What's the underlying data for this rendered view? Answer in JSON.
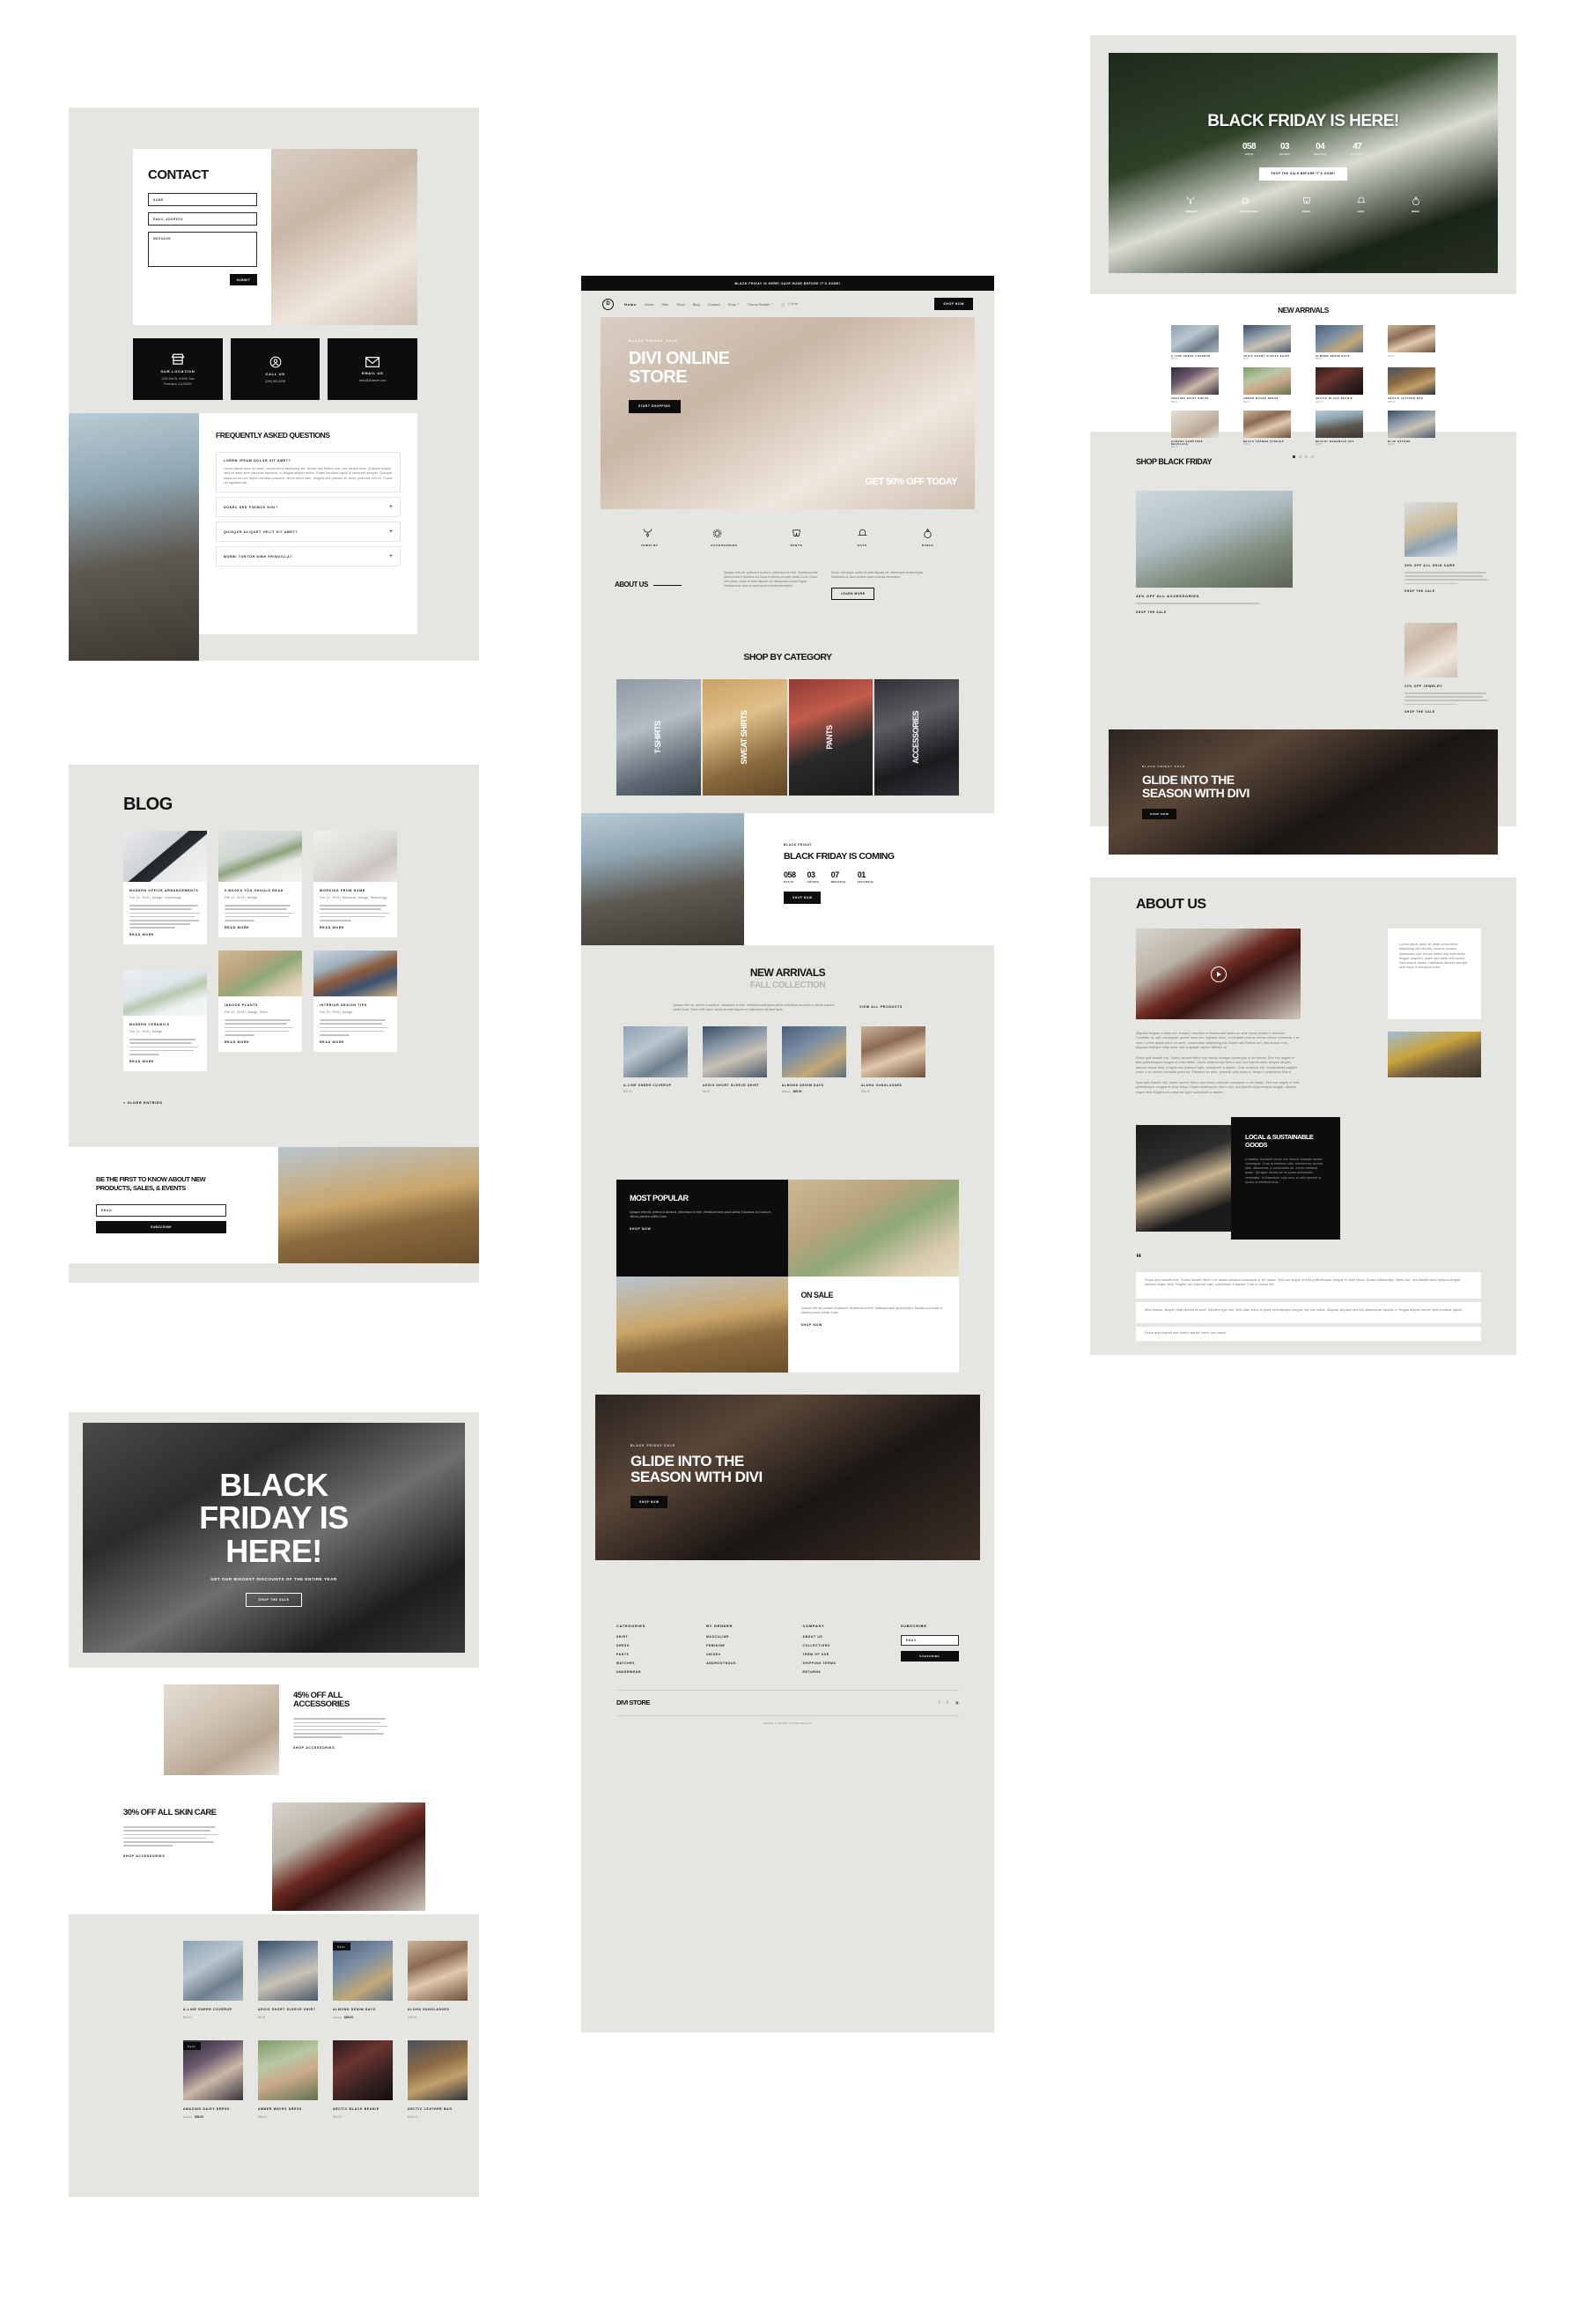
{
  "contact_page": {
    "title": "CONTACT",
    "form": {
      "name_placeholder": "NAME",
      "email_placeholder": "EMAIL ADDRESS",
      "message_placeholder": "MESSAGE",
      "submit_label": "SUBMIT"
    },
    "info_cards": [
      {
        "icon": "store-icon",
        "title": "OUR LOCATION",
        "line1": "1234 Divi St. #1000, San",
        "line2": "Francisco, CA 94220"
      },
      {
        "icon": "phone-user-icon",
        "title": "CALL US",
        "line1": "(255) 352-6258",
        "line2": ""
      },
      {
        "icon": "envelope-icon",
        "title": "EMAIL US",
        "line1": "hello@divistore.com",
        "line2": ""
      }
    ],
    "faq": {
      "title": "FREQUENTLY ASKED QUESTIONS",
      "items": [
        {
          "q": "LOREM IPSUM DOLOR SIT AMET?",
          "open": true,
          "a": "Lorem ipsum dolor sit amet, consectetur adipiscing elit. Donec sed finibus nisi, sed dictum eros. Quisque aliquet velit sit amet sem interdum faucibus. In feugiat aliquet mollis. Etiam tincidunt ligula ut hendrerit semper. Quisque luctus tortor non turpis interdum posuere. Morbi tortor nibh, fringilla sed pretium sit amet, pharetra non ex. Fusce vel egestas nisl."
        },
        {
          "q": "DONEC SED FINIBUS NISI?",
          "open": false,
          "a": ""
        },
        {
          "q": "QUISQUE ALIQUET VELIT SIT AMET?",
          "open": false,
          "a": ""
        },
        {
          "q": "MORBI TORTOR NIBH FRINGILLA?",
          "open": false,
          "a": ""
        }
      ]
    }
  },
  "blog_page": {
    "title": "BLOG",
    "read_more": "READ MORE",
    "older_entries": "« OLDER ENTRIES",
    "posts": [
      {
        "title": "MODERN OFFICE ARRANGEMENTS",
        "meta": "Feb 12, 2019 | Design, Technology",
        "img": "img-blog1"
      },
      {
        "title": "5 BOOKS YOU SHOULD READ",
        "meta": "Feb 12, 2019 | Design",
        "img": "img-blog2"
      },
      {
        "title": "WORKING FROM HOME",
        "meta": "Feb 12, 2019 | Business, Design, Technology",
        "img": "img-blog3"
      },
      {
        "title": "MODERN CERAMICS",
        "meta": "Feb 12, 2019 | Design",
        "img": "img-blog4"
      },
      {
        "title": "INDOOR PLANTS",
        "meta": "Feb 12, 2019 | Design, Store",
        "img": "img-blog5"
      },
      {
        "title": "INTERIOR DESIGN TIPS",
        "meta": "Feb 12, 2019 | Design",
        "img": "img-blog6"
      }
    ],
    "newsletter": {
      "heading": "BE THE FIRST TO KNOW ABOUT NEW PRODUCTS, SALES, & EVENTS",
      "email_placeholder": "EMAIL",
      "button_label": "SUBSCRIBE"
    }
  },
  "black_friday_page": {
    "hero": {
      "title": "BLACK FRIDAY IS HERE!",
      "subtitle": "GET OUR BIGGEST DISCOUNTS OF THE ENTIRE YEAR",
      "button_label": "SHOP THE SALE"
    },
    "promo_accessories": {
      "title": "45% OFF ALL ACCESSORIES",
      "link_label": "SHOP ACCESSORIES"
    },
    "promo_skincare": {
      "title": "30% OFF ALL SKIN CARE",
      "link_label": "SHOP ACCESSORIES"
    },
    "products": [
      {
        "name": "A-LINE SHEER COVERUP",
        "price": "$67.00",
        "old_price": "",
        "badge": "",
        "img": "p1"
      },
      {
        "name": "AEGIS SHORT SLEEVE SHIRT",
        "price": "$6.00",
        "old_price": "",
        "badge": "",
        "img": "p2"
      },
      {
        "name": "ALMOND DENIM DAYS",
        "price": "$68.00",
        "old_price": "$95.00",
        "badge": "Sale!",
        "img": "p3"
      },
      {
        "name": "ALOHA SUNGLASSES",
        "price": "$48.00",
        "old_price": "",
        "badge": "",
        "img": "p4"
      },
      {
        "name": "AMAZING DAISY DRESS",
        "price": "$56.00",
        "old_price": "$80.00",
        "badge": "Sale!",
        "img": "p5"
      },
      {
        "name": "AMBER WAVES DRESS",
        "price": "$64.00",
        "old_price": "",
        "badge": "",
        "img": "p6"
      },
      {
        "name": "ARCTIC BLACK BEANIE",
        "price": "$22.00",
        "old_price": "",
        "badge": "",
        "img": "p7"
      },
      {
        "name": "ARCTIC LEATHER BAG",
        "price": "$150.00",
        "old_price": "",
        "badge": "",
        "img": "p8"
      }
    ]
  },
  "home_page": {
    "announcement": "BLACK FRIDAY IS HERE! SAVE HUGE BEFORE IT'S GONE!",
    "logo": "D",
    "nav": [
      {
        "label": "Home",
        "active": true,
        "caret": false
      },
      {
        "label": "About",
        "active": false,
        "caret": false
      },
      {
        "label": "Sale",
        "active": false,
        "caret": false
      },
      {
        "label": "Shop",
        "active": false,
        "caret": false
      },
      {
        "label": "Blog",
        "active": false,
        "caret": false
      },
      {
        "label": "Contact",
        "active": false,
        "caret": false
      },
      {
        "label": "Shop",
        "active": false,
        "caret": true
      },
      {
        "label": "Theme Builder",
        "active": false,
        "caret": true
      }
    ],
    "cart_label": "0 Items",
    "nav_button": "SHOP NOW",
    "hero": {
      "eyebrow": "BLACK FRIDAY SALE",
      "title": "DIVI ONLINE STORE",
      "button_label": "START SHOPPING",
      "corner_text": "GET 50% OFF TODAY"
    },
    "categories_icons": [
      {
        "icon": "necklace-icon",
        "label": "JEWELRY"
      },
      {
        "icon": "wreath-icon",
        "label": "ACCESSORIES"
      },
      {
        "icon": "shorts-icon",
        "label": "PANTS"
      },
      {
        "icon": "hat-icon",
        "label": "HATS"
      },
      {
        "icon": "ring-icon",
        "label": "RINGS"
      }
    ],
    "about": {
      "title": "ABOUT US",
      "col1": "Quisque velit nisi, pretium ut lacinia in, elementum id enim. Vestibulum ante ipsum primis in faucibus orci luctus et ultrices posuere cubilia Curae. Donec velit neque, auctor sit amet aliquam vel, ullamcorper sit amet ligula. Vestibulum ac diam sit amet quam vehicula elementum.",
      "col2": "Donec velit neque, auctor sit amet aliquam vel, ullamcorper sit amet ligula. Vestibulum ac diam sit amet quam vehicula elementum.",
      "button_label": "LEARN MORE"
    },
    "shop_by_category": {
      "title": "SHOP BY CATEGORY",
      "tiles": [
        {
          "label": "T-SHIRTS",
          "img": "tshirt"
        },
        {
          "label": "SWEAT SHIRTS",
          "img": "sweat"
        },
        {
          "label": "PANTS",
          "img": "pants"
        },
        {
          "label": "ACCESSORIES",
          "img": "access"
        }
      ]
    },
    "countdown_section": {
      "eyebrow": "BLACK FRIDAY",
      "title": "BLACK FRIDAY IS COMING",
      "units": [
        {
          "value": "058",
          "label": "DAY(S)"
        },
        {
          "value": "03",
          "label": "HOUR(S)"
        },
        {
          "value": "07",
          "label": "MINUTE(S)"
        },
        {
          "value": "01",
          "label": "SECOND(S)"
        }
      ],
      "button_label": "SHOP NOW"
    },
    "new_arrivals": {
      "title": "NEW ARRIVALS",
      "subtitle": "FALL COLLECTION",
      "blurb": "Quisque velit nisi, pretium ut lacinia in, elementum id enim. Vestibulum ante ipsum primis in faucibus orci luctus et ultrices posuere cubilia Curae. Donec velit neque, auctor sit amet aliquam vel, ullamcorper sit amet ligula.",
      "view_all": "VIEW ALL PRODUCTS",
      "products": [
        {
          "name": "A-LINE SHEER COVERUP",
          "price": "$67.00",
          "old_price": "",
          "img": "p1"
        },
        {
          "name": "AEGIS SHORT SLEEVE SHIRT",
          "price": "$6.00",
          "old_price": "",
          "img": "p2"
        },
        {
          "name": "ALMOND DENIM DAYS",
          "price": "$68.00",
          "old_price": "$95.00",
          "img": "p3"
        },
        {
          "name": "ALOHA SUNGLASSES",
          "price": "$48.00",
          "old_price": "",
          "img": "p4"
        }
      ]
    },
    "most_popular": {
      "title": "MOST POPULAR",
      "body": "Quisque velit nisi, pretium ut lacinia in, elementum id enim. Vestibulum ante ipsum primis in faucibus orci luctus et ultrices posuere cubilia Curae.",
      "button_label": "SHOP NOW"
    },
    "on_sale": {
      "title": "ON SALE",
      "body": "Quisque velit nisi, pretium ut lacinia in, elementum id enim. Vestibulum ante ipsum primis in faucibus orci luctus et ultrices posuere cubilia Curae.",
      "button_label": "SHOP NOW"
    },
    "glide": {
      "eyebrow": "BLACK FRIDAY SALE",
      "title": "GLIDE INTO THE SEASON WITH DIVI",
      "button_label": "SHOP NOW"
    },
    "footer": {
      "columns": [
        {
          "heading": "CATEGORIES",
          "links": [
            "SHIRT",
            "DRESS",
            "PANTS",
            "WATCHES",
            "UNDERWEAR"
          ]
        },
        {
          "heading": "BY GENDER",
          "links": [
            "MASCULINE",
            "FEMININE",
            "UNISEX",
            "ANDROGYNOUS"
          ]
        },
        {
          "heading": "COMPANY",
          "links": [
            "ABOUT US",
            "COLLECTIONS",
            "TERM OF USE",
            "SHIPPING TERMS",
            "RETURNS"
          ]
        }
      ],
      "subscribe": {
        "heading": "SUBSCRIBE",
        "email_placeholder": "EMAIL",
        "button_label": "SUBSCRIBE"
      },
      "brand": "DIVI STORE",
      "socials": [
        "facebook-icon",
        "twitter-x-icon",
        "instagram-icon"
      ],
      "copyright": "Copyright © 2019 Divi. All Rights Reserved."
    }
  },
  "bf_landing_page": {
    "hero": {
      "title": "BLACK FRIDAY IS HERE!",
      "units": [
        {
          "value": "058",
          "label": "DAY(S)"
        },
        {
          "value": "03",
          "label": "HOUR(S)"
        },
        {
          "value": "04",
          "label": "MINUTE(S)"
        },
        {
          "value": "47",
          "label": "SECOND(S)"
        }
      ],
      "button_label": "SHOP THE SALE BEFORE IT'S GONE!",
      "icons": [
        {
          "icon": "necklace-icon",
          "label": "JEWELRY"
        },
        {
          "icon": "wreath-icon",
          "label": "ACCESSORIES"
        },
        {
          "icon": "shorts-icon",
          "label": "PANTS"
        },
        {
          "icon": "hat-icon",
          "label": "HATS"
        },
        {
          "icon": "ring-icon",
          "label": "RINGS"
        }
      ]
    },
    "new_arrivals": {
      "title": "NEW ARRIVALS",
      "products": [
        {
          "name": "A-LINE SHEER COVERUP",
          "price": "$67.00",
          "img": "p1"
        },
        {
          "name": "AEGIS SHORT SLEEVE SHIRT",
          "price": "$6.00",
          "img": "p2"
        },
        {
          "name": "ALMOND DENIM DAYS",
          "price": "$68.00",
          "img": "p3"
        },
        {
          "name": "ALOHA SUNGLASSES",
          "price": "$48.00",
          "img": "p4"
        },
        {
          "name": "AMAZING DAISY DRESS",
          "price": "$56.00",
          "img": "p5"
        },
        {
          "name": "AMBER WAVES DRESS",
          "price": "$64.00",
          "img": "p6"
        },
        {
          "name": "ARCTIC BLACK BEANIE",
          "price": "$22.00",
          "img": "p7"
        },
        {
          "name": "ARCTIC LEATHER BAG",
          "price": "$150.00",
          "img": "p8"
        },
        {
          "name": "AURORA GEMSTONE NECKLACE",
          "price": "$52.00",
          "img": "img-jewel"
        },
        {
          "name": "BEACH FRAMED SUNNIES",
          "price": "$45.00",
          "img": "p4"
        },
        {
          "name": "BEACHY BOHEMIAN HAT",
          "price": "$38.00",
          "img": "img-hat"
        },
        {
          "name": "BLUE OXFORD",
          "price": "$60.00",
          "img": "p2"
        }
      ]
    },
    "shop_section": {
      "title": "SHOP BLACK FRIDAY",
      "accessories": {
        "title": "45% OFF ALL ACCESSORIES",
        "link_label": "SHOP THE SALE"
      },
      "skincare": {
        "title": "30% OFF ALL SKIN CARE",
        "link_label": "SHOP THE SALE"
      },
      "jewelry": {
        "title": "20% OFF JEWELRY",
        "link_label": "SHOP THE SALE"
      }
    },
    "glide": {
      "eyebrow": "BLACK FRIDAY SALE",
      "title": "GLIDE INTO THE SEASON WITH DIVI",
      "button_label": "SHOP NOW"
    }
  },
  "about_page": {
    "title": "ABOUT US",
    "video_caption": "play-button",
    "side_note": "Lorem ipsum dolor sit amet consectetur adipiscing elit lobortis, viverra conubia maecenas eget rutrum metus nisl sollicitudin feugiat torquent, quam sed diam velit luctus cum mauris fames. Habitasse laoreet suscipit sem risus ut tincidunt tortor.",
    "body1": "Aliquam feugiat ut diam non tempus, interdum et malesuada fames ac ante ipsum primis in faucibus. Curabitur ac odio consequat, auctor risus nec, egestas dolor. In sit amet urna ac metus dictum commodo a at nunc. Lorem ipsum dolor sit amet, consectetur adipiscing elit. Donec sed finibus nisi, sed dictum eros. Aliquam tristique nulla dolor, sed vulputate sapien efficitur at.",
    "body2": "Etiam quis blandit nisl. Donec laoreet libero non metus volutpat consequat in vel metus. Sed non augue et felis pellentesque congue et vitae tellus. Donec ullamcorper libero nisl, nec blandit dolor tempus feugiat, danesn neque felis, fringilla nec placerat eget, sollicitudin a sapien. Cras ut auctor elit. Suspendisse sagittis lorem a ex ornare convallis pharetra. Praesent ex ante, placerat quis purus a, tempor consectetur libero.",
    "body3": "Nam quis blandit nisl, donec laoreet libero non metus volutpat consequat in vel metus. Sed non augue et felis pellentesque congue et vitae tellus. Donec ullamcorper libero nisl, nec blandit dolor tempus feugiat, danesn neque felis fringilla nec placerat eget, sollicitudin a sapien.",
    "goods": {
      "title": "LOCAL & SUSTAINABLE GOODS",
      "body": "Curabitur tincidunt lorem non dictum aliquam auctor consequat. Cras id eleifend odio, elementum lacinia nibh. Maecenas in sollicitudin mi, donec eleifend quam. Quisque dictum ex ut quam sollicitudin venenatis. In bibendum odio arcu at odio laoreet ut luctus ut eleifend eros."
    },
    "quote_icon": "quote-mark",
    "testimonials": [
      "Fusce quis blandit erat. Donec laoreet libero non metus volutpat consequat in vel metus. Sed non augue et felis pellentesque congue et vitae tellus. Donec ullamcorper libero nisl, nec blandit dolor tempus feugiat. Aenean neque felis, fringilla nec placerat eget, sollicitudin a sapien. Cras ut auctor elit.",
      "Nibh mauris, aliquet vitae laoreet id amet, ultricies eget nisl. Sed vitae tellus id porta pellentesque congue nec non tellus. Aliquam aliquam sed nisi ullamcorper lacinia, in feugiat aliquet rutrum velit tincidunt ipsum."
    ],
    "testimonial_footer": "Fusce quis blandit erat donec laoreet libero non metus."
  },
  "colors": {
    "page_bg": "#e5e5e1",
    "card_bg": "#ffffff",
    "accent_dark": "#0d0d0d",
    "muted_text": "#757575",
    "sale_red": "#0d0d0d"
  }
}
